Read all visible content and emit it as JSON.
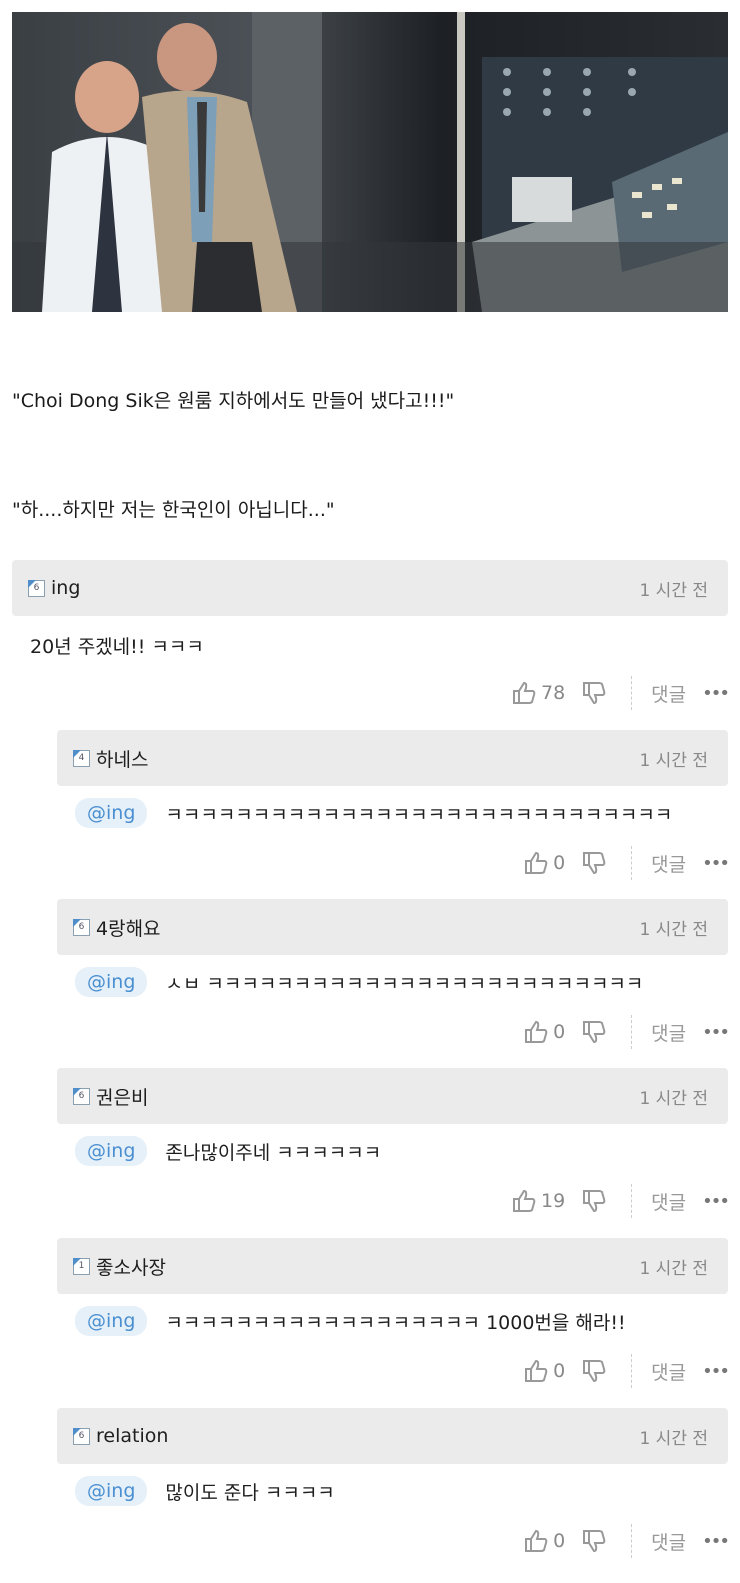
{
  "post": {
    "caption_1": "\"Choi Dong Sik은 원룸 지하에서도 만들어 냈다고!!!\"",
    "caption_2": "\"하....하지만 저는 한국인이 아닙니다...\""
  },
  "comment": {
    "level": "6",
    "user": "ing",
    "time": "1 시간 전",
    "text": "20년 주겠네!! ㅋㅋㅋ",
    "likes": "78",
    "reply_label": "댓글",
    "more_label": "•••"
  },
  "replies": [
    {
      "level": "4",
      "user": "하네스",
      "time": "1 시간 전",
      "mention": "@ing",
      "text": "ㅋㅋㅋㅋㅋㅋㅋㅋㅋㅋㅋㅋㅋㅋㅋㅋㅋㅋㅋㅋㅋㅋㅋㅋㅋㅋㅋㅋㅋ",
      "likes": "0",
      "reply_label": "댓글",
      "more_label": "•••"
    },
    {
      "level": "6",
      "user": "4랑해요",
      "time": "1 시간 전",
      "mention": "@ing",
      "text": "ㅅㅂ ㅋㅋㅋㅋㅋㅋㅋㅋㅋㅋㅋㅋㅋㅋㅋㅋㅋㅋㅋㅋㅋㅋㅋㅋㅋ",
      "likes": "0",
      "reply_label": "댓글",
      "more_label": "•••"
    },
    {
      "level": "6",
      "user": "권은비",
      "time": "1 시간 전",
      "mention": "@ing",
      "text": "존나많이주네 ㅋㅋㅋㅋㅋㅋ",
      "likes": "19",
      "reply_label": "댓글",
      "more_label": "•••"
    },
    {
      "level": "1",
      "user": "좋소사장",
      "time": "1 시간 전",
      "mention": "@ing",
      "text": "ㅋㅋㅋㅋㅋㅋㅋㅋㅋㅋㅋㅋㅋㅋㅋㅋㅋㅋ 1000번을 해라!!",
      "likes": "0",
      "reply_label": "댓글",
      "more_label": "•••"
    },
    {
      "level": "6",
      "user": "relation",
      "time": "1 시간 전",
      "mention": "@ing",
      "text": "많이도 준다 ㅋㅋㅋㅋ",
      "likes": "0",
      "reply_label": "댓글",
      "more_label": "•••"
    }
  ]
}
